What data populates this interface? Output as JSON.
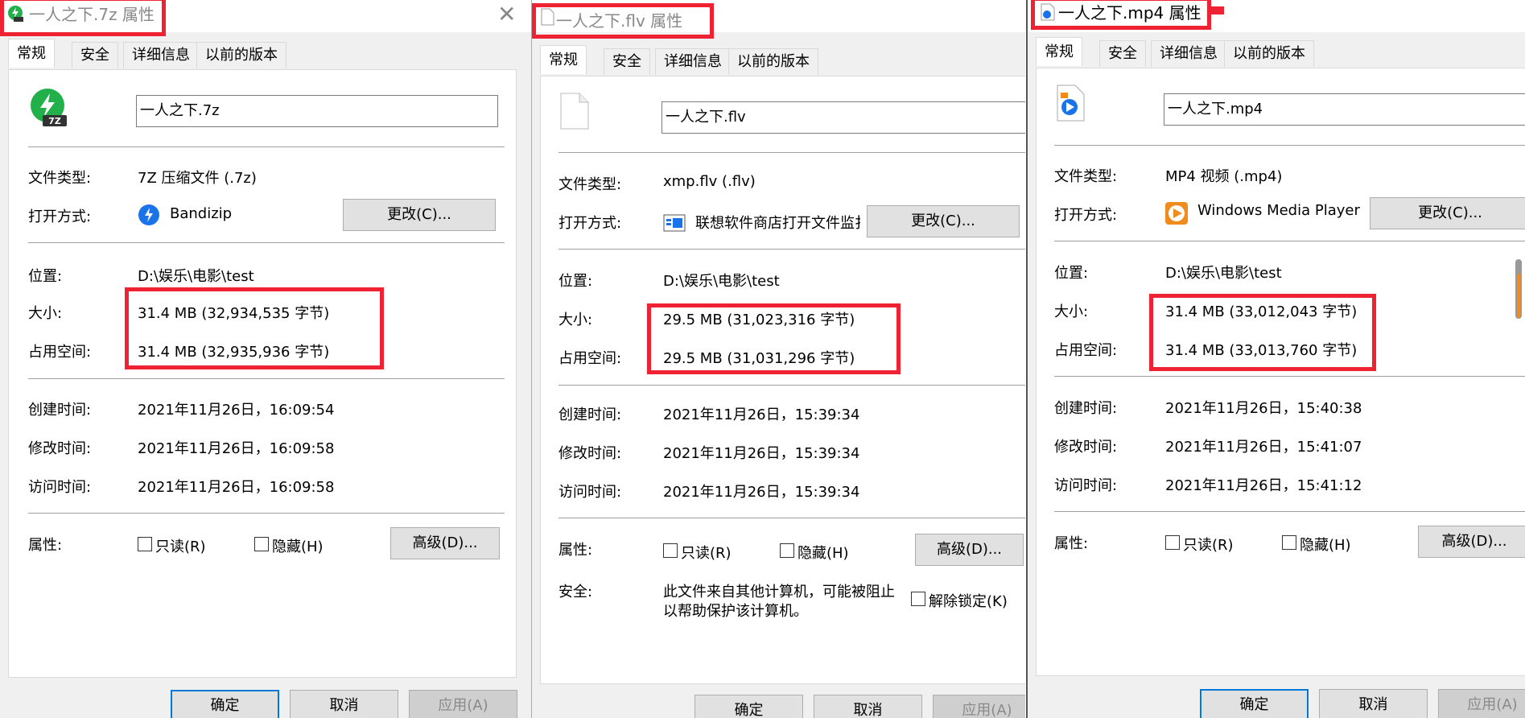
{
  "colors": {
    "highlight": "#ee2233",
    "accent": "#0078d7",
    "zip_green": "#22b04a",
    "bandizip_blue": "#1a73e8",
    "wmp_orange": "#f08c1e"
  },
  "labels": {
    "type": "文件类型:",
    "opens_with": "打开方式:",
    "location": "位置:",
    "size": "大小:",
    "size_on_disk": "占用空间:",
    "created": "创建时间:",
    "modified": "修改时间:",
    "accessed": "访问时间:",
    "attributes": "属性:",
    "security": "安全:"
  },
  "dialogs": [
    {
      "title": "一人之下.7z 属性",
      "tabs": [
        "常规",
        "安全",
        "详细信息",
        "以前的版本"
      ],
      "icon": "7z-archive-icon",
      "icon_badge": "7Z",
      "filename": "一人之下.7z",
      "type": "7Z 压缩文件 (.7z)",
      "opens_with": "Bandizip",
      "opens_with_icon": "bandizip-icon",
      "change_button": "更改(C)...",
      "location": "D:\\娱乐\\电影\\test",
      "size": "31.4 MB (32,934,535 字节)",
      "size_on_disk": "31.4 MB (32,935,936 字节)",
      "created": "2021年11月26日，16:09:54",
      "modified": "2021年11月26日，16:09:58",
      "accessed": "2021年11月26日，16:09:58",
      "readonly": "只读(R)",
      "hidden": "隐藏(H)",
      "advanced_button": "高级(D)...",
      "ok": "确定",
      "cancel": "取消",
      "apply": "应用(A)"
    },
    {
      "title": "一人之下.flv 属性",
      "tabs": [
        "常规",
        "安全",
        "详细信息",
        "以前的版本"
      ],
      "icon": "blank-file-icon",
      "filename": "一人之下.flv",
      "type": "xmp.flv (.flv)",
      "opens_with": "联想软件商店打开文件监扌",
      "opens_with_icon": "lenovo-app-icon",
      "change_button": "更改(C)...",
      "location": "D:\\娱乐\\电影\\test",
      "size": "29.5 MB (31,023,316 字节)",
      "size_on_disk": "29.5 MB (31,031,296 字节)",
      "created": "2021年11月26日，15:39:34",
      "modified": "2021年11月26日，15:39:34",
      "accessed": "2021年11月26日，15:39:34",
      "readonly": "只读(R)",
      "hidden": "隐藏(H)",
      "advanced_button": "高级(D)...",
      "security_text_1": "此文件来自其他计算机，可能被阻止",
      "security_text_2": "以帮助保护该计算机。",
      "unblock": "解除锁定(K)",
      "ok": "确定",
      "cancel": "取消",
      "apply": "应用(A)"
    },
    {
      "title": "一人之下.mp4 属性",
      "tabs": [
        "常规",
        "安全",
        "详细信息",
        "以前的版本"
      ],
      "icon": "mp4-video-icon",
      "filename": "一人之下.mp4",
      "type": "MP4 视频 (.mp4)",
      "opens_with": "Windows Media Player",
      "opens_with_icon": "wmp-icon",
      "change_button": "更改(C)...",
      "location": "D:\\娱乐\\电影\\test",
      "size": "31.4 MB (33,012,043 字节)",
      "size_on_disk": "31.4 MB (33,013,760 字节)",
      "created": "2021年11月26日，15:40:38",
      "modified": "2021年11月26日，15:41:07",
      "accessed": "2021年11月26日，15:41:12",
      "readonly": "只读(R)",
      "hidden": "隐藏(H)",
      "advanced_button": "高级(D)...",
      "ok": "确定",
      "cancel": "取消",
      "apply": "应用(A)"
    }
  ]
}
